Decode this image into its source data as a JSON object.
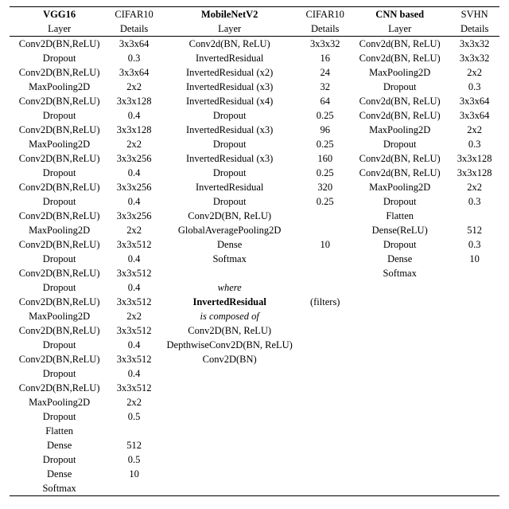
{
  "columns": [
    {
      "model": "VGG16",
      "dataset": "CIFAR10",
      "h_layer": "Layer",
      "h_detail": "Details"
    },
    {
      "model": "MobileNetV2",
      "dataset": "CIFAR10",
      "h_layer": "Layer",
      "h_detail": "Details"
    },
    {
      "model": "CNN based",
      "dataset": "SVHN",
      "h_layer": "Layer",
      "h_detail": "Details"
    }
  ],
  "vgg16_rows": [
    [
      "Conv2D(BN,ReLU)",
      "3x3x64"
    ],
    [
      "Dropout",
      "0.3"
    ],
    [
      "Conv2D(BN,ReLU)",
      "3x3x64"
    ],
    [
      "MaxPooling2D",
      "2x2"
    ],
    [
      "Conv2D(BN,ReLU)",
      "3x3x128"
    ],
    [
      "Dropout",
      "0.4"
    ],
    [
      "Conv2D(BN,ReLU)",
      "3x3x128"
    ],
    [
      "MaxPooling2D",
      "2x2"
    ],
    [
      "Conv2D(BN,ReLU)",
      "3x3x256"
    ],
    [
      "Dropout",
      "0.4"
    ],
    [
      "Conv2D(BN,ReLU)",
      "3x3x256"
    ],
    [
      "Dropout",
      "0.4"
    ],
    [
      "Conv2D(BN,ReLU)",
      "3x3x256"
    ],
    [
      "MaxPooling2D",
      "2x2"
    ],
    [
      "Conv2D(BN,ReLU)",
      "3x3x512"
    ],
    [
      "Dropout",
      "0.4"
    ],
    [
      "Conv2D(BN,ReLU)",
      "3x3x512"
    ],
    [
      "Dropout",
      "0.4"
    ],
    [
      "Conv2D(BN,ReLU)",
      "3x3x512"
    ],
    [
      "MaxPooling2D",
      "2x2"
    ],
    [
      "Conv2D(BN,ReLU)",
      "3x3x512"
    ],
    [
      "Dropout",
      "0.4"
    ],
    [
      "Conv2D(BN,ReLU)",
      "3x3x512"
    ],
    [
      "Dropout",
      "0.4"
    ],
    [
      "Conv2D(BN,ReLU)",
      "3x3x512"
    ],
    [
      "MaxPooling2D",
      "2x2"
    ],
    [
      "Dropout",
      "0.5"
    ],
    [
      "Flatten",
      ""
    ],
    [
      "Dense",
      "512"
    ],
    [
      "Dropout",
      "0.5"
    ],
    [
      "Dense",
      "10"
    ],
    [
      "Softmax",
      ""
    ]
  ],
  "mnv2_rows": [
    [
      "Conv2d(BN, ReLU)",
      "3x3x32"
    ],
    [
      "InvertedResidual",
      "16"
    ],
    [
      "InvertedResidual (x2)",
      "24"
    ],
    [
      "InvertedResidual (x3)",
      "32"
    ],
    [
      "InvertedResidual (x4)",
      "64"
    ],
    [
      "Dropout",
      "0.25"
    ],
    [
      "InvertedResidual (x3)",
      "96"
    ],
    [
      "Dropout",
      "0.25"
    ],
    [
      "InvertedResidual (x3)",
      "160"
    ],
    [
      "Dropout",
      "0.25"
    ],
    [
      "InvertedResidual",
      "320"
    ],
    [
      "Dropout",
      "0.25"
    ],
    [
      "Conv2D(BN, ReLU)",
      ""
    ],
    [
      "GlobalAveragePooling2D",
      ""
    ],
    [
      "Dense",
      "10"
    ],
    [
      "Softmax",
      ""
    ]
  ],
  "mnv2_note": {
    "where": "where",
    "name": "InvertedResidual",
    "name_detail": "(filters)",
    "composed": "is composed of",
    "rows": [
      [
        "Conv2D(BN, ReLU)",
        ""
      ],
      [
        "DepthwiseConv2D(BN, ReLU)",
        ""
      ],
      [
        "Conv2D(BN)",
        ""
      ]
    ]
  },
  "cnn_rows": [
    [
      "Conv2d(BN, ReLU)",
      "3x3x32"
    ],
    [
      "Conv2d(BN, ReLU)",
      "3x3x32"
    ],
    [
      "MaxPooling2D",
      "2x2"
    ],
    [
      "Dropout",
      "0.3"
    ],
    [
      "Conv2d(BN, ReLU)",
      "3x3x64"
    ],
    [
      "Conv2d(BN, ReLU)",
      "3x3x64"
    ],
    [
      "MaxPooling2D",
      "2x2"
    ],
    [
      "Dropout",
      "0.3"
    ],
    [
      "Conv2d(BN, ReLU)",
      "3x3x128"
    ],
    [
      "Conv2d(BN, ReLU)",
      "3x3x128"
    ],
    [
      "MaxPooling2D",
      "2x2"
    ],
    [
      "Dropout",
      "0.3"
    ],
    [
      "Flatten",
      ""
    ],
    [
      "Dense(ReLU)",
      "512"
    ],
    [
      "Dropout",
      "0.3"
    ],
    [
      "Dense",
      "10"
    ],
    [
      "Softmax",
      ""
    ]
  ]
}
